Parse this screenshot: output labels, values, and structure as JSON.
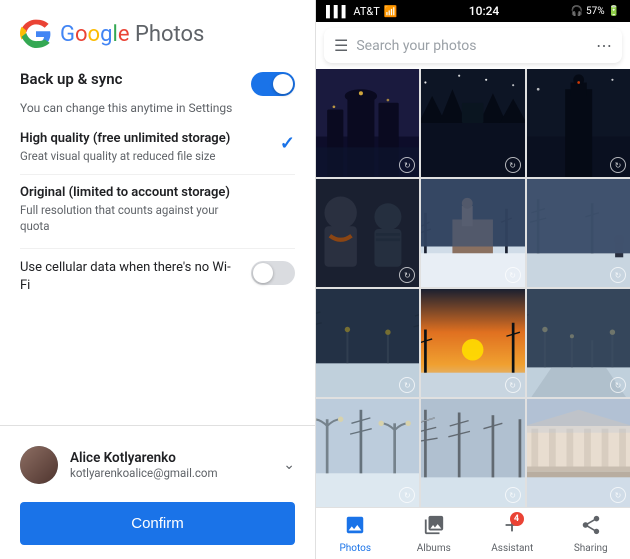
{
  "left": {
    "logo": {
      "google": "Google",
      "photos": "Photos"
    },
    "backup": {
      "title": "Back up & sync",
      "subtitle": "You can change this anytime in Settings",
      "toggle_on": true
    },
    "high_quality": {
      "label": "High quality (free unlimited storage)",
      "desc": "Great visual quality at reduced file size",
      "selected": true
    },
    "original": {
      "label": "Original (limited to account storage)",
      "desc": "Full resolution that counts against your quota",
      "selected": false
    },
    "cellular": {
      "label": "Use cellular data when there's no Wi-Fi",
      "toggle_on": false
    },
    "account": {
      "name": "Alice Kotlyarenko",
      "email": "kotlyarenkoalice@gmail.com"
    },
    "confirm_btn": "Confirm"
  },
  "right": {
    "status_bar": {
      "carrier": "AT&T",
      "time": "10:24",
      "battery": "57%"
    },
    "search": {
      "placeholder": "Search your photos"
    },
    "nav": {
      "photos": "Photos",
      "albums": "Albums",
      "assistant": "Assistant",
      "sharing": "Sharing",
      "assistant_badge": "4"
    }
  }
}
